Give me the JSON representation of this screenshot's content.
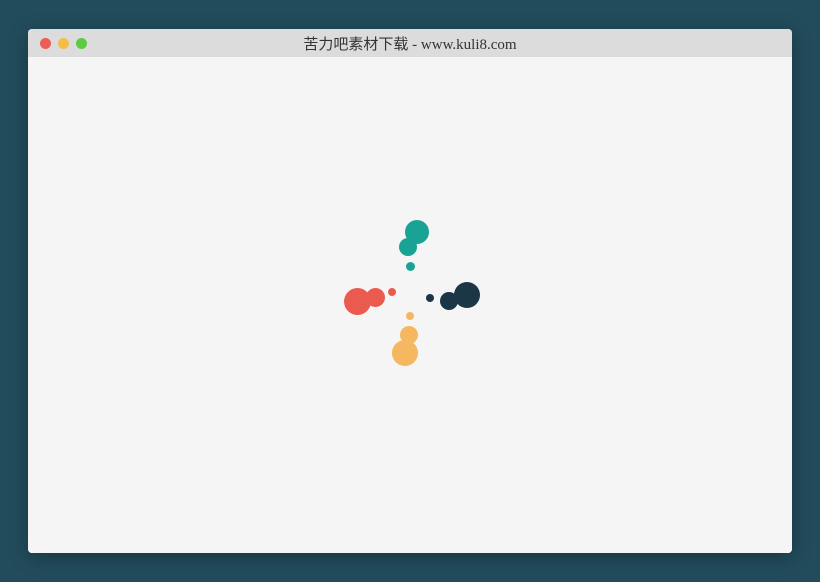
{
  "window": {
    "title": "苦力吧素材下载 - www.kuli8.com"
  },
  "loader": {
    "colors": {
      "top": "#1aa394",
      "right": "#1b3647",
      "bottom": "#f5b75f",
      "left": "#ea5a4e"
    }
  }
}
